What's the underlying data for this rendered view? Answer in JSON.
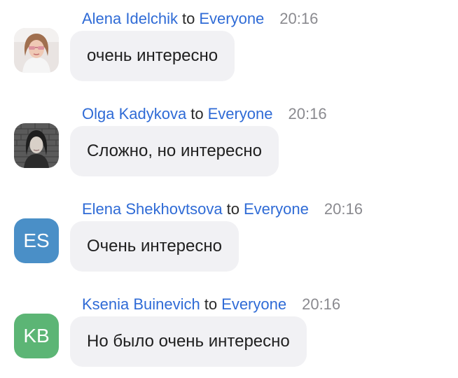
{
  "colors": {
    "name_link": "#2f6bd6",
    "timestamp": "#8a8a8f",
    "bubble_bg": "#f1f1f4",
    "avatar_es": "#4a8fc7",
    "avatar_kb": "#5cb575"
  },
  "messages": [
    {
      "sender": "Alena Idelchik",
      "to_word": "to",
      "recipient": "Everyone",
      "time": "20:16",
      "text": "очень интересно",
      "avatar": {
        "type": "photo",
        "icon": "user-photo-alena"
      }
    },
    {
      "sender": "Olga Kadykova",
      "to_word": "to",
      "recipient": "Everyone",
      "time": "20:16",
      "text": "Сложно, но интересно",
      "avatar": {
        "type": "photo",
        "icon": "user-photo-olga"
      }
    },
    {
      "sender": "Elena Shekhovtsova",
      "to_word": "to",
      "recipient": "Everyone",
      "time": "20:16",
      "text": "Очень интересно",
      "avatar": {
        "type": "initials",
        "initials": "ES",
        "color": "#4a8fc7"
      }
    },
    {
      "sender": "Ksenia Buinevich",
      "to_word": "to",
      "recipient": "Everyone",
      "time": "20:16",
      "text": "Но было очень интересно",
      "avatar": {
        "type": "initials",
        "initials": "KB",
        "color": "#5cb575"
      }
    }
  ]
}
